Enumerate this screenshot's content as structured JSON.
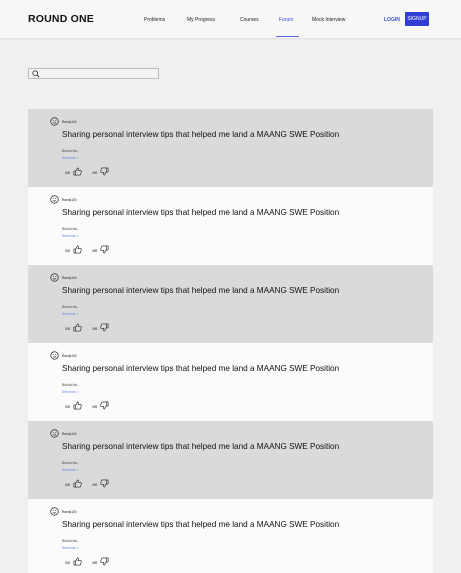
{
  "header": {
    "logo": "ROUND ONE",
    "nav": [
      "Problems",
      "My Progress",
      "Courses",
      "Forum",
      "Mock Interview"
    ],
    "active_nav": "Forum",
    "login": "LOGIN",
    "signup": "SIGNUP",
    "accent_color": "#3f4bd9"
  },
  "search": {
    "value": "",
    "placeholder": "",
    "icon": "search-icon"
  },
  "posts": [
    {
      "user": "Randy100",
      "title": "Sharing personal interview tips that helped me land a MAANG SWE Position",
      "body": "Bla bla bla...",
      "more": "See more >",
      "likes": "500",
      "dislikes": "499"
    },
    {
      "user": "Randy100",
      "title": "Sharing personal interview tips that helped me land a MAANG SWE Position",
      "body": "Bla bla bla...",
      "more": "See more >",
      "likes": "500",
      "dislikes": "499"
    },
    {
      "user": "Randy100",
      "title": "Sharing personal interview tips that helped me land a MAANG SWE Position",
      "body": "Bla bla bla...",
      "more": "See more >",
      "likes": "500",
      "dislikes": "499"
    },
    {
      "user": "Randy100",
      "title": "Sharing personal interview tips that helped me land a MAANG SWE Position",
      "body": "Bla bla bla...",
      "more": "See more >",
      "likes": "500",
      "dislikes": "499"
    },
    {
      "user": "Randy100",
      "title": "Sharing personal interview tips that helped me land a MAANG SWE Position",
      "body": "Bla bla bla...",
      "more": "See more >",
      "likes": "500",
      "dislikes": "499"
    },
    {
      "user": "Randy100",
      "title": "Sharing personal interview tips that helped me land a MAANG SWE Position",
      "body": "Bla bla bla...",
      "more": "See more >",
      "likes": "500",
      "dislikes": "499"
    }
  ]
}
